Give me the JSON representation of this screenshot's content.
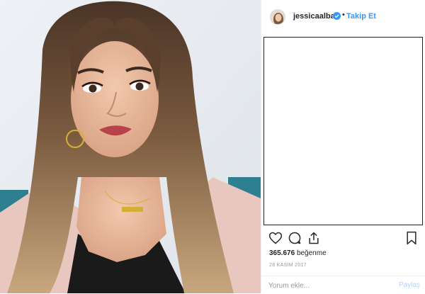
{
  "post": {
    "username": "jessicaalba",
    "separator": "•",
    "follow_label": "Takip Et",
    "likes_count": "365.676",
    "likes_word": "beğenme",
    "date": "28 KASIM 2017"
  },
  "comment": {
    "placeholder": "Yorum ekle...",
    "share_label": "Paylaş"
  },
  "colors": {
    "accent": "#3897f0",
    "share_disabled": "#b3d4fc",
    "text": "#262626",
    "muted": "#999999"
  },
  "icons": {
    "like": "heart-icon",
    "comment": "comment-icon",
    "share": "share-icon",
    "save": "bookmark-icon",
    "verified": "verified-badge-icon"
  }
}
